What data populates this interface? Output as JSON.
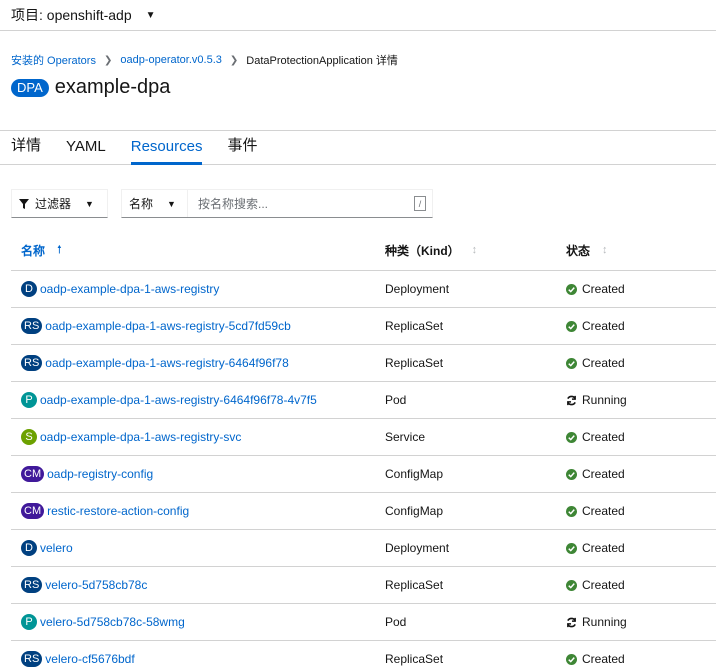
{
  "project": {
    "label": "项目: openshift-adp"
  },
  "breadcrumb": [
    {
      "label": "安装的 Operators"
    },
    {
      "label": "oadp-operator.v0.5.3"
    },
    {
      "label": "DataProtectionApplication 详情"
    }
  ],
  "header": {
    "badge": "DPA",
    "title": "example-dpa"
  },
  "tabs": [
    "详情",
    "YAML",
    "Resources",
    "事件"
  ],
  "toolbar": {
    "filter_label": "过滤器",
    "name_select": "名称",
    "search_placeholder": "按名称搜索...",
    "search_hint": "/"
  },
  "table": {
    "headers": [
      "名称",
      "种类（Kind）",
      "状态"
    ],
    "rows": [
      {
        "badge": "D",
        "badge_color": "#004080",
        "name": "oadp-example-dpa-1-aws-registry",
        "kind": "Deployment",
        "status": "Created"
      },
      {
        "badge": "RS",
        "badge_color": "#004080",
        "name": "oadp-example-dpa-1-aws-registry-5cd7fd59cb",
        "kind": "ReplicaSet",
        "status": "Created"
      },
      {
        "badge": "RS",
        "badge_color": "#004080",
        "name": "oadp-example-dpa-1-aws-registry-6464f96f78",
        "kind": "ReplicaSet",
        "status": "Created"
      },
      {
        "badge": "P",
        "badge_color": "#009596",
        "name": "oadp-example-dpa-1-aws-registry-6464f96f78-4v7f5",
        "kind": "Pod",
        "status": "Running"
      },
      {
        "badge": "S",
        "badge_color": "#6ca100",
        "name": "oadp-example-dpa-1-aws-registry-svc",
        "kind": "Service",
        "status": "Created"
      },
      {
        "badge": "CM",
        "badge_color": "#40199a",
        "name": "oadp-registry-config",
        "kind": "ConfigMap",
        "status": "Created"
      },
      {
        "badge": "CM",
        "badge_color": "#40199a",
        "name": "restic-restore-action-config",
        "kind": "ConfigMap",
        "status": "Created"
      },
      {
        "badge": "D",
        "badge_color": "#004080",
        "name": "velero",
        "kind": "Deployment",
        "status": "Created"
      },
      {
        "badge": "RS",
        "badge_color": "#004080",
        "name": "velero-5d758cb78c",
        "kind": "ReplicaSet",
        "status": "Created"
      },
      {
        "badge": "P",
        "badge_color": "#009596",
        "name": "velero-5d758cb78c-58wmg",
        "kind": "Pod",
        "status": "Running"
      },
      {
        "badge": "RS",
        "badge_color": "#004080",
        "name": "velero-cf5676bdf",
        "kind": "ReplicaSet",
        "status": "Created"
      }
    ]
  },
  "colors": {
    "link": "#0066cc",
    "success": "#3e8635",
    "border": "#d2d2d2"
  }
}
